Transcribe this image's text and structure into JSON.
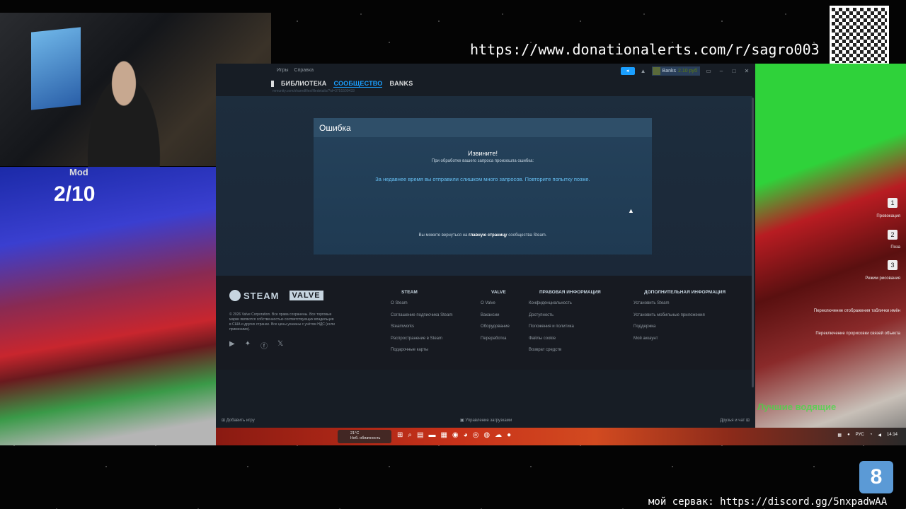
{
  "stream": {
    "donation_url": "https://www.donationalerts.com/r/sagro003",
    "discord_text": "мой сервак: https://discord.gg/5nxpadwAA"
  },
  "game_left": {
    "mod_label": "Mod",
    "score": "2/10"
  },
  "game_right": {
    "hud_items": [
      {
        "key": "1",
        "label": "Провокация"
      },
      {
        "key": "2",
        "label": "Поза"
      },
      {
        "key": "3",
        "label": "Режим рисования"
      }
    ],
    "notes": [
      "Переключение отображения таблички имён",
      "Переключение прорисовки связей объекта"
    ],
    "overlay": "Лучшие водящие"
  },
  "steam": {
    "menu": [
      "Игры",
      "Справка"
    ],
    "user_name": "Banks",
    "balance": "2.10 руб",
    "nav": [
      "БИБЛИОТЕКА",
      "СООБЩЕСТВО",
      "BANKS"
    ],
    "url": "mmunity.com/sharedfiles/filedetails/?id=3751509433",
    "error": {
      "heading": "Ошибка",
      "title": "Извините!",
      "subtitle": "При обработке вашего запроса произошла ошибка:",
      "message": "За недавнее время вы отправили слишком много запросов. Повторите попытку позже.",
      "return_prefix": "Вы можете вернуться на",
      "return_link": "главную страницу",
      "return_suffix": "сообщества Steam."
    },
    "footer": {
      "steam_logo": "STEAM",
      "valve_logo": "VALVE",
      "copyright": "© 2026 Valve Corporation. Все права сохранены. Все торговые марки являются собственностью соответствующих владельцев в США и других странах. Все цены указаны с учётом НДС (если применимо).",
      "columns": [
        {
          "title": "STEAM",
          "links": [
            "О Steam",
            "Соглашение подписчика Steam",
            "Steamworks",
            "Распространение в Steam",
            "Подарочные карты"
          ]
        },
        {
          "title": "VALVE",
          "links": [
            "О Valve",
            "Вакансии",
            "Оборудование",
            "Переработка"
          ]
        },
        {
          "title": "ПРАВОВАЯ ИНФОРМАЦИЯ",
          "links": [
            "Конфиденциальность",
            "Доступность",
            "Положения и политика",
            "Файлы cookie",
            "Возврат средств"
          ]
        },
        {
          "title": "ДОПОЛНИТЕЛЬНАЯ ИНФОРМАЦИЯ",
          "links": [
            "Установить Steam",
            "Установить мобильные приложения",
            "Поддержка",
            "Мой аккаунт"
          ]
        }
      ]
    },
    "status": {
      "add_game": "Добавить игру",
      "downloads": "Управление загрузками",
      "friends": "Друзья и чат"
    }
  },
  "taskbar": {
    "temp": "21°C",
    "weather": "Неб. облачность",
    "lang": "РУС",
    "time": "14:14"
  },
  "icons": [
    "youtube-icon",
    "bluesky-icon",
    "facebook-icon",
    "x-icon"
  ]
}
